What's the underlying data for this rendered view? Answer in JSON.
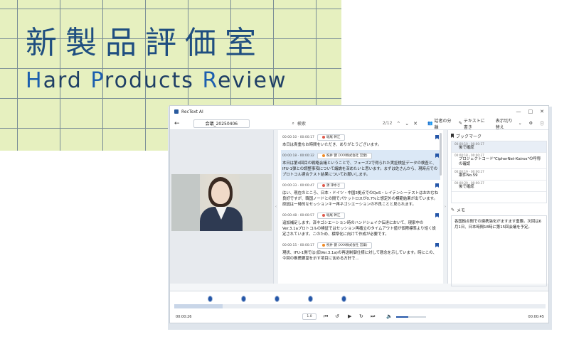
{
  "banner": {
    "title": "新製品評価室",
    "subtitle_parts": [
      "H",
      "ard ",
      "P",
      "roducts ",
      "R",
      "eview"
    ]
  },
  "app": {
    "name": "RecText AI",
    "window_controls": [
      "—",
      "□",
      "✕"
    ]
  },
  "toolbar": {
    "back_glyph": "←",
    "meeting_name": "会議_20250406",
    "search_icon": "⌕",
    "search_value": "検索",
    "match_count": "2/12",
    "prev_glyph": "⌃",
    "next_glyph": "⌄",
    "close_glyph": "✕",
    "speaker_split": "話者の分離",
    "text_rewrite": "テキストに書き",
    "display_toggle": "表示切り替え"
  },
  "transcript": [
    {
      "time": "00:00:10 - 00:00:17",
      "speaker": "堀尾 幹江",
      "color": "#e05a4b",
      "text": "本日は貴重なお時間をいただき、ありがとうございます。",
      "active": false
    },
    {
      "time": "00:00:18 - 00:00:32",
      "speaker": "祝井 健 (XXX株式会社 営業)",
      "color": "#f08a24",
      "text": "本日は第4回目の戦略会議ということで、フェーズ2で得られた実証検証データの検査と、IFU-1弾との調整事項について議論を深めたいと思います。まずは佐さんから、現時点でのプロトコル適合テスト結果についてお願いします。",
      "active": true
    },
    {
      "time": "00:00:33 - 00:00:47",
      "speaker": "源 津水さ",
      "color": "#e05a4b",
      "text": "はい、現在のところ、日本・ドイツ・中国3拠点でのQoS・レイテンシーテストはおおむね良好ですが、韓国ノードとの間でパケットロスが0.7%と想定外の模範結果が出ています。原因は一時的なセッションキー再ネゴシエーションの不良ことと見られます。",
      "active": false
    },
    {
      "time": "00:00:48 - 00:00:57",
      "speaker": "堀尾 幹江",
      "color": "#e05a4b",
      "text": "追加補足します。済ネゴシエーション時のハンドシェイク伝達において、現家中のVer.3.1aプロトコルの検証ではセッション再確立のタイムアウト値が個際標準より短く設定されています。このため、標準化に向けて作成が必要です。",
      "active": false
    },
    {
      "time": "00:00:15 - 00:00:17",
      "speaker": "祝井 健 (XXX株式会社 営業)",
      "color": "#f08a24",
      "text": "現状、IFU-1側では(旧Ver.3.1a)の再送制御仕様に対して懸念を示しています。時にこの、今回の推薦要望を示す項目に含める方針で…",
      "active": false
    }
  ],
  "sidebar": {
    "bookmark_header": "ブックマーク",
    "bookmarks": [
      {
        "time": "00:00:10 - 00:00:17",
        "title": "後で確認",
        "selected": true
      },
      {
        "time": "00:00:18 - 00:00:27",
        "title": "プロジェクトコード\"CipherNet-Kairos\"の呼称の確認",
        "selected": false
      },
      {
        "time": "00:00:19 - 00:00:27",
        "title": "案件No.59",
        "selected": false
      },
      {
        "time": "00:00:29 - 00:00:37",
        "title": "後で確認",
        "selected": false
      }
    ],
    "memo_header": "メモ",
    "memo_text": "各国拠点間での連携強化がますます重要。次回は6月1日、日本時間18時に第15回会議を予定。"
  },
  "player": {
    "current_time": "00:00:26",
    "total_time": "00:00:45",
    "speed": "1.0",
    "progress": 0.13,
    "volume": 0.4,
    "markers": [
      0.09,
      0.18,
      0.27,
      0.36,
      0.45
    ]
  }
}
